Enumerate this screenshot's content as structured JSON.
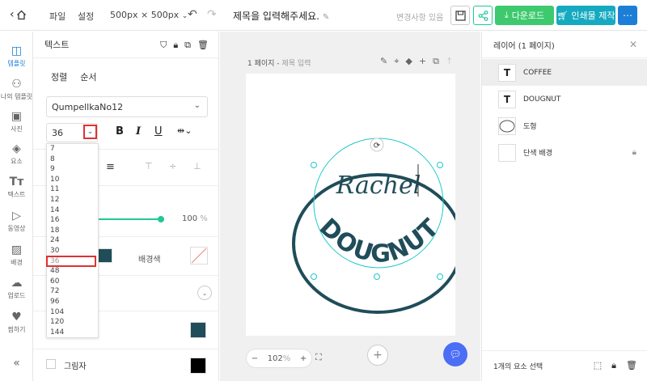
{
  "topbar": {
    "home_icon": "chevron-left-home-icon",
    "menu": [
      "파일",
      "설정"
    ],
    "page_size": "500px × 500px",
    "title": "제목을 입력해주세요.",
    "save_state": "변경사항 있음",
    "download_label": "다운로드",
    "print_label": "인쇄물 제작"
  },
  "rail": {
    "items": [
      {
        "label": "템플릿",
        "icon": "template-icon"
      },
      {
        "label": "나의 템플릿",
        "icon": "my-template-icon"
      },
      {
        "label": "사진",
        "icon": "photo-icon"
      },
      {
        "label": "요소",
        "icon": "elements-icon"
      },
      {
        "label": "텍스트",
        "icon": "text-icon"
      },
      {
        "label": "동영상",
        "icon": "video-icon"
      },
      {
        "label": "배경",
        "icon": "background-icon"
      },
      {
        "label": "업로드",
        "icon": "upload-icon"
      },
      {
        "label": "찜하기",
        "icon": "heart-icon"
      }
    ]
  },
  "panel": {
    "title": "텍스트",
    "tabs": [
      "정렬",
      "순서"
    ],
    "font": "QumpellkaNo12",
    "font_size": "36",
    "opacity_value": "100",
    "opacity_unit": "%",
    "text_color": "#1f4d59",
    "bg_label": "배경색",
    "border_color": "#1f4d59",
    "shadow_label": "그림자",
    "shadow_color": "#000000"
  },
  "size_dropdown": {
    "options": [
      "7",
      "8",
      "9",
      "10",
      "11",
      "12",
      "14",
      "16",
      "18",
      "24",
      "30",
      "36",
      "48",
      "60",
      "72",
      "96",
      "104",
      "120",
      "144"
    ],
    "selected": "36"
  },
  "canvas": {
    "page_label": "1 페이지",
    "page_title": "제목 입력",
    "zoom": "102",
    "zoom_unit": "%",
    "text_top": "Rachel",
    "text_bottom": "DOUGNUT"
  },
  "layers": {
    "title": "레이어 (1 페이지)",
    "items": [
      {
        "name": "COFFEE",
        "thumb": "T",
        "selected": true
      },
      {
        "name": "DOUGNUT",
        "thumb": "T",
        "selected": false
      },
      {
        "name": "도형",
        "thumb": "ellipse",
        "selected": false
      },
      {
        "name": "단색 배경",
        "thumb": "",
        "selected": false,
        "locked": true
      }
    ],
    "footer": "1개의 요소 선택"
  },
  "colors": {
    "accent_blue": "#1c7ed6",
    "download_green": "#3ec96e",
    "print_teal": "#15aabf",
    "logo_dark": "#1f4d59",
    "selection_teal": "#20c9c9"
  }
}
